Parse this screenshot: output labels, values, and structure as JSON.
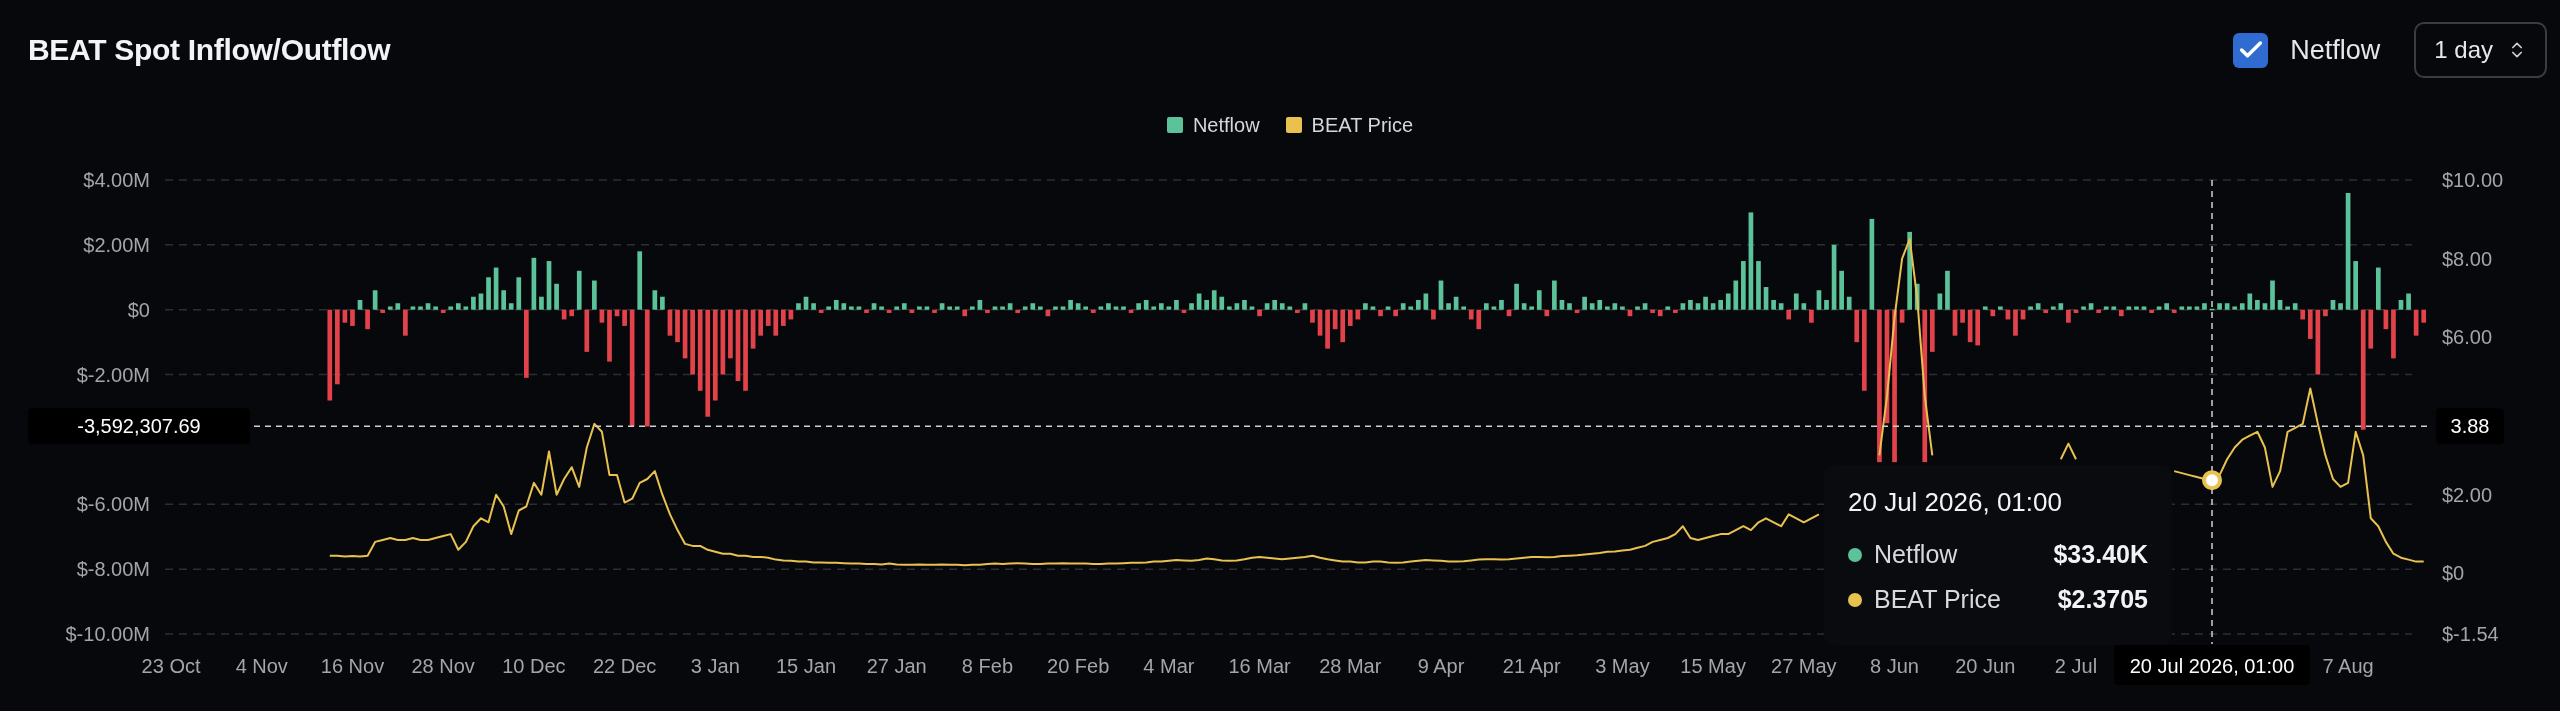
{
  "header": {
    "title": "BEAT Spot Inflow/Outflow",
    "netflow_toggle": {
      "label": "Netflow",
      "checked": true
    },
    "interval_select": {
      "value": "1 day"
    }
  },
  "netflow_chart": {
    "chart_data": {
      "type": "bar",
      "grid": true,
      "ylim": [
        -10,
        4
      ],
      "yticks": [
        {
          "value": 4,
          "label": "$4.00M"
        },
        {
          "value": 2,
          "label": "$2.00M"
        },
        {
          "value": 0,
          "label": "$0"
        },
        {
          "value": -2,
          "label": "$-2.00M"
        },
        {
          "value": -6,
          "label": "$-6.00M"
        },
        {
          "value": -8,
          "label": "$-8.00M"
        },
        {
          "value": -10,
          "label": "$-10.00M"
        }
      ],
      "categories": [
        "23 Oct",
        null,
        null,
        null,
        null,
        null,
        null,
        null,
        null,
        null,
        null,
        null,
        "4 Nov",
        null,
        null,
        null,
        null,
        null,
        null,
        null,
        null,
        null,
        null,
        null,
        "16 Nov",
        null,
        null,
        null,
        null,
        null,
        null,
        null,
        null,
        null,
        null,
        null,
        "28 Nov",
        null,
        null,
        null,
        null,
        null,
        null,
        null,
        null,
        null,
        null,
        null,
        "10 Dec",
        null,
        null,
        null,
        null,
        null,
        null,
        null,
        null,
        null,
        null,
        null,
        "22 Dec",
        null,
        null,
        null,
        null,
        null,
        null,
        null,
        null,
        null,
        null,
        null,
        "3 Jan",
        null,
        null,
        null,
        null,
        null,
        null,
        null,
        null,
        null,
        null,
        null,
        "15 Jan",
        null,
        null,
        null,
        null,
        null,
        null,
        null,
        null,
        null,
        null,
        null,
        "27 Jan",
        null,
        null,
        null,
        null,
        null,
        null,
        null,
        null,
        null,
        null,
        null,
        "8 Feb",
        null,
        null,
        null,
        null,
        null,
        null,
        null,
        null,
        null,
        null,
        null,
        "20 Feb",
        null,
        null,
        null,
        null,
        null,
        null,
        null,
        null,
        null,
        null,
        null,
        "4 Mar",
        null,
        null,
        null,
        null,
        null,
        null,
        null,
        null,
        null,
        null,
        null,
        "16 Mar",
        null,
        null,
        null,
        null,
        null,
        null,
        null,
        null,
        null,
        null,
        null,
        "28 Mar",
        null,
        null,
        null,
        null,
        null,
        null,
        null,
        null,
        null,
        null,
        null,
        "9 Apr",
        null,
        null,
        null,
        null,
        null,
        null,
        null,
        null,
        null,
        null,
        null,
        "21 Apr",
        null,
        null,
        null,
        null,
        null,
        null,
        null,
        null,
        null,
        null,
        null,
        "3 May",
        null,
        null,
        null,
        null,
        null,
        null,
        null,
        null,
        null,
        null,
        null,
        "15 May",
        null,
        null,
        null,
        null,
        null,
        null,
        null,
        null,
        null,
        null,
        null,
        "27 May",
        null,
        null,
        null,
        null,
        null,
        null,
        null,
        null,
        null,
        null,
        null,
        "8 Jun",
        null,
        null,
        null,
        null,
        null,
        null,
        null,
        null,
        null,
        null,
        null,
        "20 Jun",
        null,
        null,
        null,
        null,
        null,
        null,
        null,
        null,
        null,
        null,
        null,
        "2 Jul",
        null,
        null,
        null,
        null,
        null,
        null,
        null,
        null,
        null,
        null,
        null,
        null,
        null,
        null,
        null,
        null,
        null,
        null,
        null,
        null,
        null,
        null,
        null,
        null,
        null,
        null,
        null,
        null,
        null,
        null,
        null,
        null,
        null,
        null,
        null,
        "7 Aug",
        null,
        null,
        null,
        null,
        null,
        null,
        null,
        null,
        null,
        null
      ],
      "series": [
        {
          "name": "Netflow",
          "color": "#5cc29a",
          "values": [
            null,
            null,
            null,
            null,
            null,
            null,
            null,
            null,
            null,
            null,
            null,
            null,
            null,
            null,
            null,
            null,
            null,
            null,
            null,
            null,
            null,
            null,
            null,
            null,
            null,
            0.3,
            null,
            0.6,
            null,
            0.1,
            0.2,
            null,
            0.1,
            0.1,
            0.2,
            0.1,
            null,
            0.1,
            0.2,
            0.1,
            0.4,
            0.5,
            1.0,
            1.3,
            0.6,
            0.2,
            1.0,
            null,
            1.6,
            0.4,
            1.5,
            0.8,
            null,
            null,
            1.2,
            null,
            0.9,
            null,
            null,
            null,
            null,
            null,
            1.8,
            null,
            0.6,
            0.4,
            null,
            null,
            null,
            null,
            null,
            null,
            null,
            null,
            null,
            null,
            null,
            null,
            null,
            null,
            null,
            null,
            null,
            0.2,
            0.4,
            0.2,
            null,
            0.1,
            0.3,
            0.2,
            0.1,
            0.1,
            null,
            0.2,
            0.1,
            null,
            0.1,
            0.2,
            null,
            0.1,
            0.1,
            null,
            0.2,
            0.1,
            0.1,
            null,
            0.1,
            0.3,
            null,
            0.1,
            0.1,
            0.2,
            null,
            0.1,
            0.2,
            0.1,
            null,
            0.1,
            0.1,
            0.3,
            0.2,
            0.1,
            null,
            0.1,
            0.2,
            0.1,
            0.1,
            null,
            0.2,
            0.3,
            0.1,
            0.2,
            0.1,
            0.3,
            null,
            0.2,
            0.5,
            0.3,
            0.6,
            0.4,
            0.1,
            0.2,
            0.3,
            0.1,
            null,
            0.2,
            0.3,
            0.2,
            0.1,
            null,
            0.2,
            null,
            null,
            null,
            null,
            null,
            null,
            null,
            0.2,
            0.1,
            null,
            0.1,
            null,
            0.2,
            0.1,
            0.3,
            0.5,
            null,
            0.9,
            0.2,
            0.4,
            0.1,
            null,
            null,
            0.2,
            0.1,
            0.3,
            null,
            0.8,
            0.2,
            0.1,
            0.6,
            null,
            0.9,
            0.3,
            0.2,
            null,
            0.4,
            0.2,
            0.3,
            0.1,
            0.2,
            0.1,
            null,
            0.1,
            0.2,
            null,
            null,
            0.1,
            null,
            0.2,
            0.3,
            0.2,
            0.4,
            0.2,
            0.3,
            0.5,
            0.9,
            1.5,
            3.0,
            1.5,
            0.7,
            0.3,
            0.2,
            null,
            0.5,
            0.2,
            null,
            0.6,
            0.3,
            2.0,
            1.2,
            0.4,
            null,
            null,
            2.8,
            null,
            null,
            null,
            null,
            2.4,
            0.8,
            null,
            null,
            0.5,
            1.2,
            null,
            null,
            null,
            null,
            0.1,
            null,
            0.1,
            null,
            null,
            null,
            0.1,
            0.2,
            null,
            0.1,
            0.2,
            null,
            null,
            0.1,
            0.2,
            null,
            0.1,
            0.1,
            null,
            0.1,
            0.1,
            0.1,
            null,
            0.1,
            0.2,
            null,
            0.1,
            0.1,
            0.1,
            0.2,
            0.03,
            0.2,
            0.2,
            0.1,
            0.2,
            0.5,
            0.3,
            0.2,
            0.9,
            0.3,
            0.1,
            0.2,
            null,
            null,
            null,
            null,
            0.3,
            0.2,
            3.6,
            1.5,
            null,
            null,
            1.3,
            null,
            null,
            0.3,
            0.5,
            null,
            null
          ]
        },
        {
          "color": "#e2434b",
          "values": [
            null,
            null,
            null,
            null,
            null,
            null,
            null,
            null,
            null,
            null,
            null,
            null,
            null,
            null,
            null,
            null,
            null,
            null,
            null,
            null,
            null,
            -2.8,
            -2.3,
            -0.4,
            -0.5,
            null,
            -0.6,
            null,
            -0.1,
            null,
            null,
            -0.8,
            null,
            null,
            null,
            null,
            -0.1,
            null,
            null,
            null,
            null,
            null,
            null,
            null,
            null,
            null,
            null,
            -2.1,
            null,
            null,
            null,
            null,
            -0.3,
            -0.2,
            null,
            -1.3,
            null,
            -0.4,
            -1.6,
            -0.2,
            -0.5,
            -3.6,
            null,
            -3.6,
            null,
            null,
            -0.8,
            -1.0,
            -1.5,
            -2.0,
            -2.5,
            -3.3,
            -2.8,
            -2.0,
            -1.5,
            -2.2,
            -2.5,
            -1.2,
            -0.8,
            -0.5,
            -0.8,
            -0.5,
            -0.3,
            null,
            null,
            null,
            -0.1,
            null,
            null,
            null,
            null,
            null,
            -0.1,
            null,
            null,
            -0.1,
            null,
            null,
            -0.1,
            null,
            null,
            -0.1,
            null,
            null,
            null,
            -0.2,
            null,
            null,
            -0.1,
            null,
            null,
            null,
            -0.1,
            null,
            null,
            null,
            -0.2,
            null,
            null,
            null,
            null,
            null,
            -0.1,
            null,
            null,
            null,
            null,
            -0.1,
            null,
            null,
            null,
            null,
            null,
            null,
            -0.1,
            null,
            null,
            null,
            null,
            null,
            null,
            null,
            null,
            null,
            -0.2,
            null,
            null,
            null,
            null,
            -0.1,
            null,
            -0.4,
            -0.8,
            -1.2,
            -0.6,
            -1.0,
            -0.5,
            -0.3,
            null,
            null,
            -0.2,
            null,
            -0.2,
            null,
            null,
            null,
            null,
            -0.3,
            null,
            null,
            null,
            null,
            -0.3,
            -0.6,
            null,
            null,
            null,
            -0.2,
            null,
            null,
            null,
            null,
            -0.2,
            null,
            null,
            null,
            -0.1,
            null,
            null,
            null,
            null,
            null,
            null,
            -0.2,
            null,
            null,
            -0.1,
            -0.2,
            null,
            -0.1,
            null,
            null,
            null,
            null,
            null,
            null,
            null,
            null,
            null,
            null,
            null,
            null,
            null,
            null,
            -0.3,
            null,
            null,
            -0.4,
            null,
            null,
            null,
            null,
            null,
            -1.0,
            -2.5,
            null,
            -4.7,
            -3.5,
            -4.7,
            -0.4,
            null,
            null,
            -4.7,
            -1.3,
            null,
            null,
            -0.8,
            -0.4,
            -1.0,
            -1.1,
            null,
            -0.2,
            null,
            -0.3,
            -0.8,
            -0.3,
            null,
            null,
            -0.1,
            null,
            null,
            -0.4,
            -0.1,
            null,
            null,
            -0.1,
            null,
            null,
            -0.2,
            null,
            null,
            null,
            -0.1,
            null,
            null,
            -0.1,
            null,
            null,
            null,
            null,
            null,
            null,
            null,
            null,
            null,
            null,
            null,
            null,
            null,
            null,
            null,
            null,
            -0.3,
            -0.9,
            -2.0,
            -0.2,
            null,
            null,
            null,
            null,
            -3.7,
            -1.2,
            null,
            -0.6,
            -1.5,
            null,
            null,
            -0.8,
            -0.4
          ]
        }
      ]
    }
  },
  "price_chart": {
    "chart_data": {
      "type": "line",
      "ylim": [
        -1.54,
        10
      ],
      "yticks": [
        {
          "value": 10,
          "label": "$10.00"
        },
        {
          "value": 8,
          "label": "$8.00"
        },
        {
          "value": 6,
          "label": "$6.00"
        },
        {
          "value": 2,
          "label": "$2.00"
        },
        {
          "value": 0,
          "label": "$0"
        },
        {
          "value": -1.54,
          "label": "$-1.54"
        }
      ],
      "series": [
        {
          "name": "BEAT Price",
          "color": "#e8c14f",
          "values": [
            null,
            null,
            null,
            null,
            null,
            null,
            null,
            null,
            null,
            null,
            null,
            null,
            null,
            null,
            null,
            null,
            null,
            null,
            null,
            null,
            null,
            0.45,
            0.45,
            0.43,
            0.44,
            0.43,
            0.45,
            0.8,
            0.85,
            0.9,
            0.85,
            0.85,
            0.9,
            0.85,
            0.85,
            0.9,
            0.95,
            1.0,
            0.6,
            0.8,
            1.2,
            1.4,
            1.3,
            2.0,
            1.7,
            1.0,
            1.6,
            1.7,
            2.3,
            2.0,
            3.1,
            2.0,
            2.4,
            2.7,
            2.2,
            3.2,
            3.8,
            3.6,
            2.5,
            2.5,
            1.8,
            1.9,
            2.3,
            2.4,
            2.6,
            2.0,
            1.5,
            1.1,
            0.75,
            0.7,
            0.7,
            0.6,
            0.55,
            0.5,
            0.5,
            0.45,
            0.45,
            0.42,
            0.42,
            0.4,
            0.35,
            0.33,
            0.32,
            0.3,
            0.3,
            0.28,
            0.28,
            0.27,
            0.27,
            0.26,
            0.25,
            0.25,
            0.24,
            0.24,
            0.23,
            0.25,
            0.23,
            0.22,
            0.22,
            0.23,
            0.22,
            0.22,
            0.23,
            0.22,
            0.22,
            0.21,
            0.22,
            0.22,
            0.24,
            0.25,
            0.24,
            0.25,
            0.26,
            0.25,
            0.24,
            0.24,
            0.25,
            0.25,
            0.26,
            0.25,
            0.25,
            0.25,
            0.24,
            0.24,
            0.25,
            0.25,
            0.26,
            0.27,
            0.27,
            0.28,
            0.3,
            0.3,
            0.32,
            0.34,
            0.33,
            0.32,
            0.34,
            0.38,
            0.36,
            0.33,
            0.32,
            0.33,
            0.36,
            0.4,
            0.42,
            0.4,
            0.38,
            0.36,
            0.38,
            0.4,
            0.42,
            0.45,
            0.4,
            0.36,
            0.33,
            0.3,
            0.3,
            0.28,
            0.28,
            0.3,
            0.3,
            0.28,
            0.27,
            0.28,
            0.3,
            0.32,
            0.34,
            0.33,
            0.32,
            0.3,
            0.3,
            0.31,
            0.33,
            0.35,
            0.36,
            0.36,
            0.35,
            0.36,
            0.38,
            0.4,
            0.42,
            0.42,
            0.41,
            0.42,
            0.44,
            0.45,
            0.46,
            0.48,
            0.5,
            0.52,
            0.55,
            0.56,
            0.58,
            0.6,
            0.65,
            0.7,
            0.8,
            0.85,
            0.9,
            1.0,
            1.2,
            0.9,
            0.85,
            0.9,
            0.95,
            1.0,
            1.0,
            1.1,
            1.2,
            1.1,
            1.3,
            1.4,
            1.3,
            1.2,
            1.5,
            1.4,
            1.3,
            1.4,
            1.5,
            null,
            null,
            null,
            null,
            null,
            null,
            null,
            3.0,
            4.5,
            6.5,
            8.0,
            8.5,
            7.0,
            4.5,
            3.0,
            null,
            null,
            null,
            null,
            null,
            null,
            null,
            null,
            null,
            null,
            null,
            null,
            null,
            null,
            null,
            null,
            2.9,
            3.3,
            2.9,
            null,
            null,
            null,
            null,
            null,
            null,
            null,
            null,
            null,
            null,
            null,
            null,
            2.6,
            2.55,
            2.5,
            2.45,
            2.4,
            2.37,
            2.5,
            2.9,
            3.2,
            3.4,
            3.5,
            3.6,
            3.2,
            2.2,
            2.6,
            3.6,
            3.7,
            3.8,
            4.7,
            3.8,
            3.0,
            2.4,
            2.2,
            2.3,
            3.6,
            3.0,
            1.4,
            1.2,
            0.8,
            0.5,
            0.4,
            0.35,
            0.3,
            0.3
          ]
        }
      ]
    }
  },
  "crosshair": {
    "y_label": "-3,592,307.69",
    "y2_label": "3.88",
    "x_label": "20 Jul 2026, 01:00"
  },
  "tooltip": {
    "title": "20 Jul 2026, 01:00",
    "rows": [
      {
        "label": "Netflow",
        "value": "$33.40K",
        "color": "#5cc29a"
      },
      {
        "label": "BEAT Price",
        "value": "$2.3705",
        "color": "#e8c14f"
      }
    ]
  }
}
